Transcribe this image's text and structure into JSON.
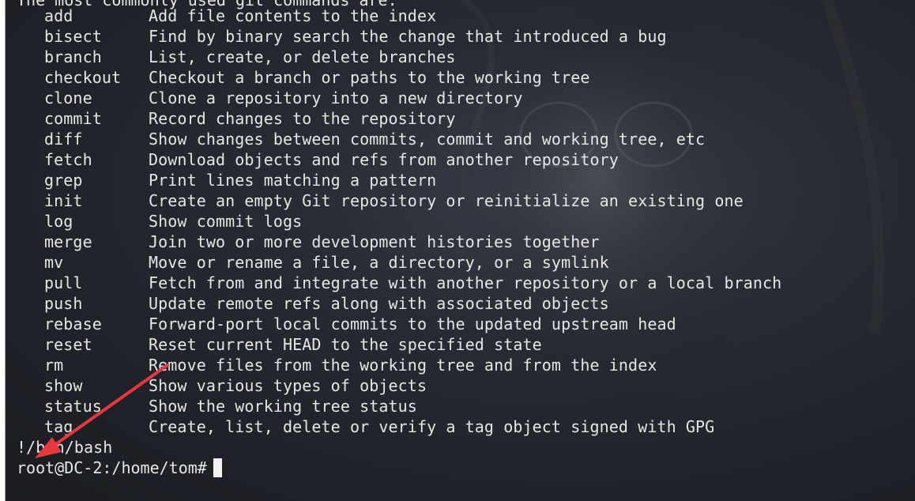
{
  "terminal": {
    "header_cut": "The most commonly used git commands are:",
    "commands": [
      {
        "cmd": "add",
        "desc": "Add file contents to the index"
      },
      {
        "cmd": "bisect",
        "desc": "Find by binary search the change that introduced a bug"
      },
      {
        "cmd": "branch",
        "desc": "List, create, or delete branches"
      },
      {
        "cmd": "checkout",
        "desc": "Checkout a branch or paths to the working tree"
      },
      {
        "cmd": "clone",
        "desc": "Clone a repository into a new directory"
      },
      {
        "cmd": "commit",
        "desc": "Record changes to the repository"
      },
      {
        "cmd": "diff",
        "desc": "Show changes between commits, commit and working tree, etc"
      },
      {
        "cmd": "fetch",
        "desc": "Download objects and refs from another repository"
      },
      {
        "cmd": "grep",
        "desc": "Print lines matching a pattern"
      },
      {
        "cmd": "init",
        "desc": "Create an empty Git repository or reinitialize an existing one"
      },
      {
        "cmd": "log",
        "desc": "Show commit logs"
      },
      {
        "cmd": "merge",
        "desc": "Join two or more development histories together"
      },
      {
        "cmd": "mv",
        "desc": "Move or rename a file, a directory, or a symlink"
      },
      {
        "cmd": "pull",
        "desc": "Fetch from and integrate with another repository or a local branch"
      },
      {
        "cmd": "push",
        "desc": "Update remote refs along with associated objects"
      },
      {
        "cmd": "rebase",
        "desc": "Forward-port local commits to the updated upstream head"
      },
      {
        "cmd": "reset",
        "desc": "Reset current HEAD to the specified state"
      },
      {
        "cmd": "rm",
        "desc": "Remove files from the working tree and from the index"
      },
      {
        "cmd": "show",
        "desc": "Show various types of objects"
      },
      {
        "cmd": "status",
        "desc": "Show the working tree status"
      },
      {
        "cmd": "tag",
        "desc": "Create, list, delete or verify a tag object signed with GPG"
      }
    ],
    "shell_line": "!/bin/bash",
    "prompt": "root@DC-2:/home/tom#",
    "annotation_color": "#e8383d",
    "background_color": "#23262d",
    "text_color": "#e6e6e6"
  }
}
